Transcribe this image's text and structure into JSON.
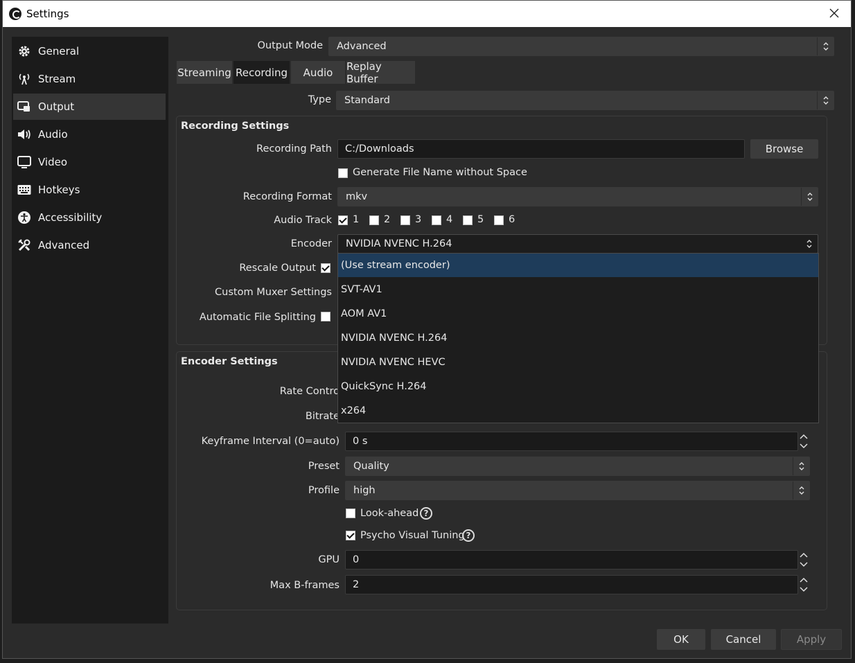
{
  "window": {
    "title": "Settings"
  },
  "sidebar": {
    "items": [
      {
        "label": "General",
        "icon": "gear-icon"
      },
      {
        "label": "Stream",
        "icon": "antenna-icon"
      },
      {
        "label": "Output",
        "icon": "output-icon"
      },
      {
        "label": "Audio",
        "icon": "speaker-icon"
      },
      {
        "label": "Video",
        "icon": "monitor-icon"
      },
      {
        "label": "Hotkeys",
        "icon": "keyboard-icon"
      },
      {
        "label": "Accessibility",
        "icon": "accessibility-icon"
      },
      {
        "label": "Advanced",
        "icon": "tools-icon"
      }
    ],
    "active": "Output"
  },
  "output": {
    "mode_label": "Output Mode",
    "mode_value": "Advanced",
    "tabs": [
      {
        "label": "Streaming"
      },
      {
        "label": "Recording"
      },
      {
        "label": "Audio"
      },
      {
        "label": "Replay Buffer"
      }
    ],
    "active_tab": "Recording",
    "type_label": "Type",
    "type_value": "Standard"
  },
  "recording": {
    "title": "Recording Settings",
    "path_label": "Recording Path",
    "path_value": "C:/Downloads",
    "browse_label": "Browse",
    "gen_name_label": "Generate File Name without Space",
    "gen_name_checked": false,
    "format_label": "Recording Format",
    "format_value": "mkv",
    "audio_track_label": "Audio Track",
    "tracks": [
      {
        "label": "1",
        "checked": true
      },
      {
        "label": "2",
        "checked": false
      },
      {
        "label": "3",
        "checked": false
      },
      {
        "label": "4",
        "checked": false
      },
      {
        "label": "5",
        "checked": false
      },
      {
        "label": "6",
        "checked": false
      }
    ],
    "encoder_label": "Encoder",
    "encoder_value": "NVIDIA NVENC H.264",
    "rescale_label": "Rescale Output",
    "rescale_checked": true,
    "muxer_label": "Custom Muxer Settings",
    "splitting_label": "Automatic File Splitting",
    "splitting_checked": false
  },
  "encoder_dropdown": {
    "options": [
      "(Use stream encoder)",
      "SVT-AV1",
      "AOM AV1",
      "NVIDIA NVENC H.264",
      "NVIDIA NVENC HEVC",
      "QuickSync H.264",
      "x264"
    ],
    "highlighted": "(Use stream encoder)"
  },
  "encoder_settings": {
    "title": "Encoder Settings",
    "rate_control_label": "Rate Contro",
    "bitrate_label": "Bitrate",
    "keyframe_label": "Keyframe Interval (0=auto)",
    "keyframe_value": "0 s",
    "preset_label": "Preset",
    "preset_value": "Quality",
    "profile_label": "Profile",
    "profile_value": "high",
    "lookahead_label": "Look-ahead",
    "lookahead_checked": false,
    "psycho_label": "Psycho Visual Tuning",
    "psycho_checked": true,
    "gpu_label": "GPU",
    "gpu_value": "0",
    "bframes_label": "Max B-frames",
    "bframes_value": "2"
  },
  "footer": {
    "ok_label": "OK",
    "cancel_label": "Cancel",
    "apply_label": "Apply"
  },
  "help_glyph": "?"
}
